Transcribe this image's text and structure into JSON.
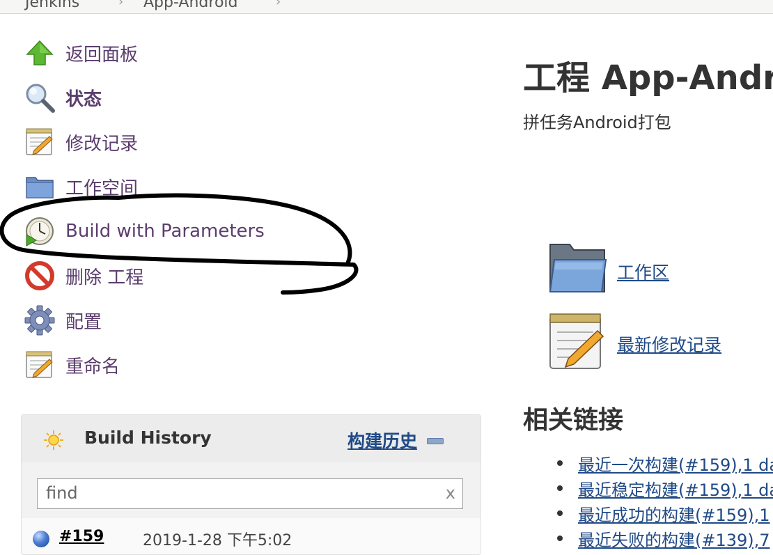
{
  "breadcrumb": {
    "items": [
      "Jenkins",
      "App-Android"
    ]
  },
  "sidebar": {
    "tasks": [
      {
        "label": "返回面板",
        "icon": "up-arrow-icon"
      },
      {
        "label": "状态",
        "icon": "magnifier-icon"
      },
      {
        "label": "修改记录",
        "icon": "notepad-icon"
      },
      {
        "label": "工作空间",
        "icon": "folder-icon"
      },
      {
        "label": "Build with Parameters",
        "icon": "clock-build-icon"
      },
      {
        "label": "删除 工程",
        "icon": "no-entry-icon"
      },
      {
        "label": "配置",
        "icon": "gear-icon"
      },
      {
        "label": "重命名",
        "icon": "notepad-icon"
      }
    ]
  },
  "build_history": {
    "title": "Build History",
    "trend_label": "构建历史",
    "search_placeholder": "find",
    "clear_label": "x",
    "builds": [
      {
        "number": "#159",
        "date": "2019-1-28 下午5:02",
        "status_color": "#4d7fd4"
      }
    ]
  },
  "main": {
    "title": "工程 App-Andr",
    "description": "拼任务Android打包",
    "workspace_link": "工作区",
    "changes_link": "最新修改记录",
    "permalinks_heading": "相关链接",
    "permalinks": [
      "最近一次构建(#159),1 da",
      "最近稳定构建(#159),1 da",
      "最近成功的构建(#159),1",
      "最近失败的构建(#139),7"
    ]
  },
  "colors": {
    "link": "#204a87",
    "task_link": "#5b3d6e",
    "build_ball": "#4d7fd4"
  }
}
